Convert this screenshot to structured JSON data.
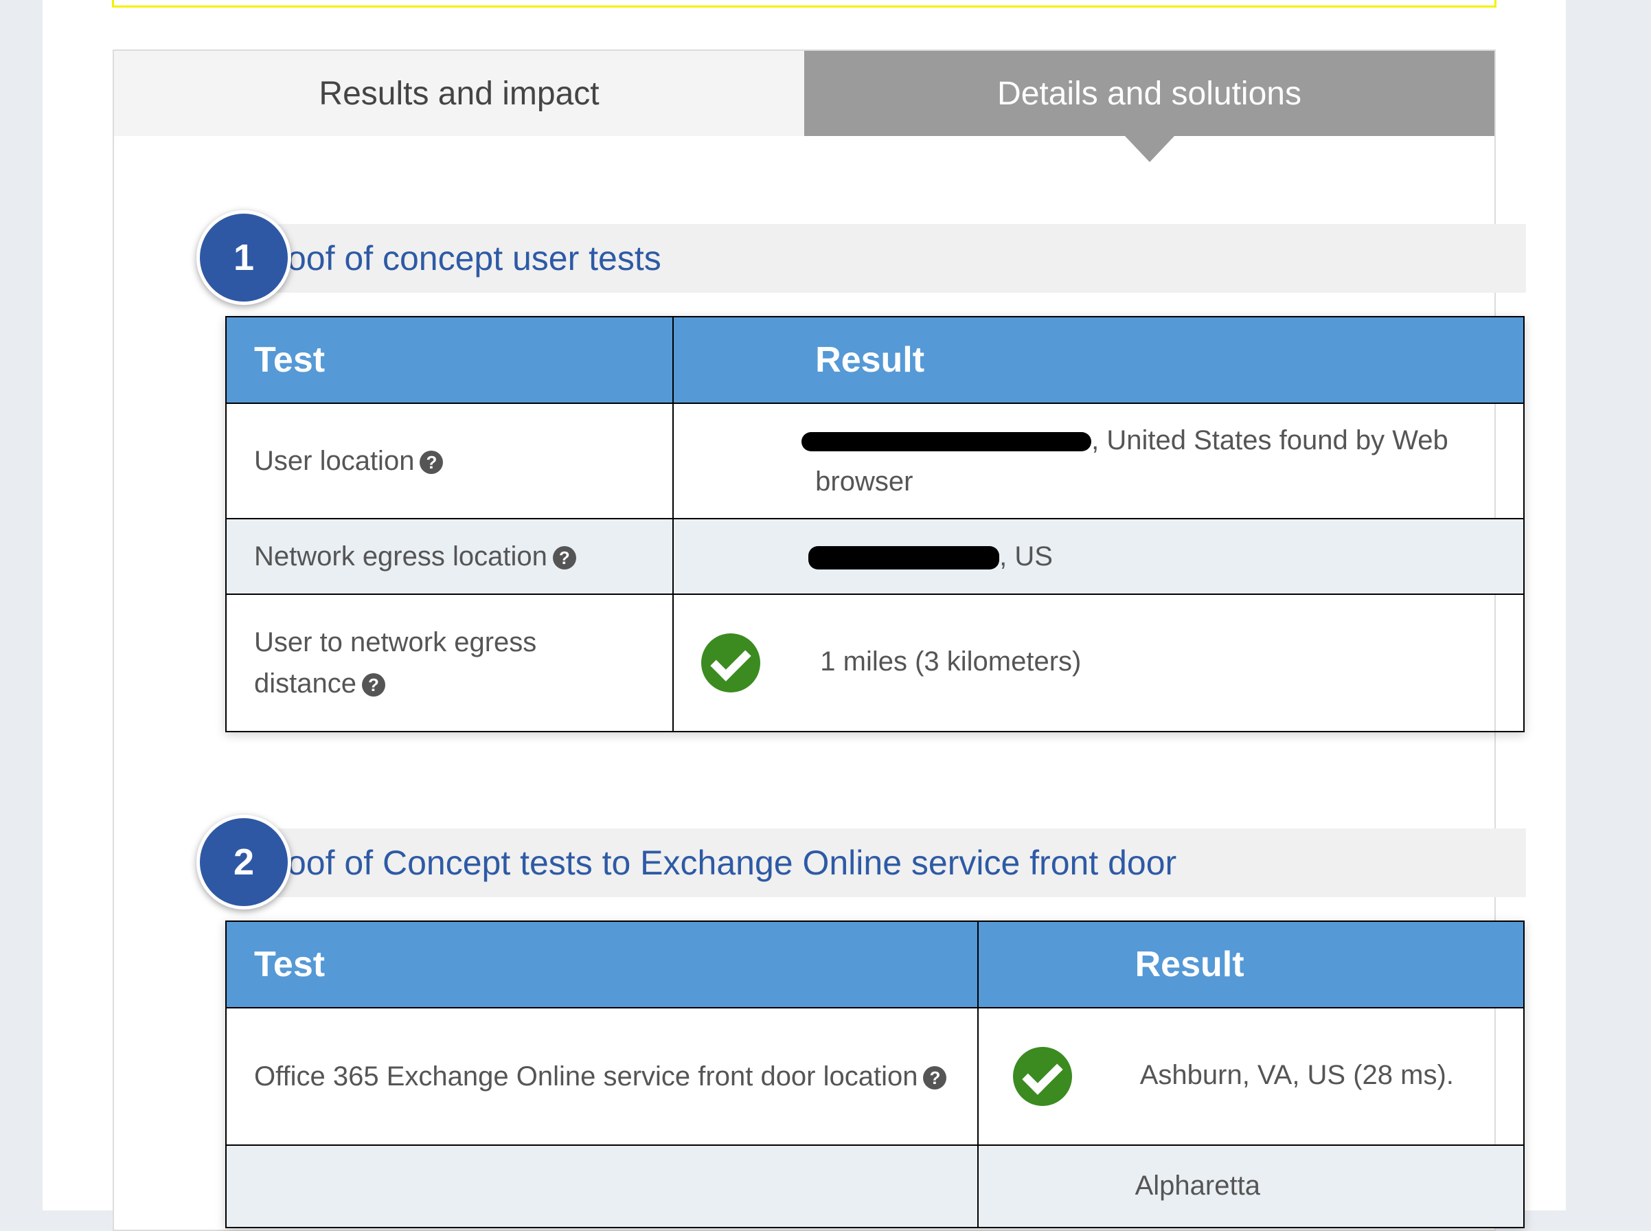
{
  "tabs": {
    "results_label": "Results and impact",
    "details_label": "Details and solutions"
  },
  "sections": [
    {
      "number": "1",
      "title": "Proof of concept user tests",
      "headers": {
        "test": "Test",
        "result": "Result"
      },
      "rows": [
        {
          "test": "User location",
          "result_suffix": ", United States found by Web",
          "result_line2": "browser"
        },
        {
          "test": "Network egress location",
          "result_suffix": ", US"
        },
        {
          "test_line1": "User to network egress",
          "test_line2": "distance",
          "result": "1 miles (3 kilometers)",
          "status_icon": "check-circle-icon"
        }
      ]
    },
    {
      "number": "2",
      "title": "Proof of Concept tests to Exchange Online service front door",
      "headers": {
        "test": "Test",
        "result": "Result"
      },
      "rows": [
        {
          "test": "Office 365 Exchange Online service front door location",
          "result": "Ashburn, VA, US (28 ms).",
          "status_icon": "check-circle-icon"
        },
        {
          "test": "",
          "result": "Alpharetta"
        }
      ]
    }
  ],
  "colors": {
    "accent": "#5599d6",
    "badge": "#2f58a4",
    "title": "#2e5aa5",
    "success": "#3b8b20",
    "tab_active": "#9b9b9b"
  }
}
